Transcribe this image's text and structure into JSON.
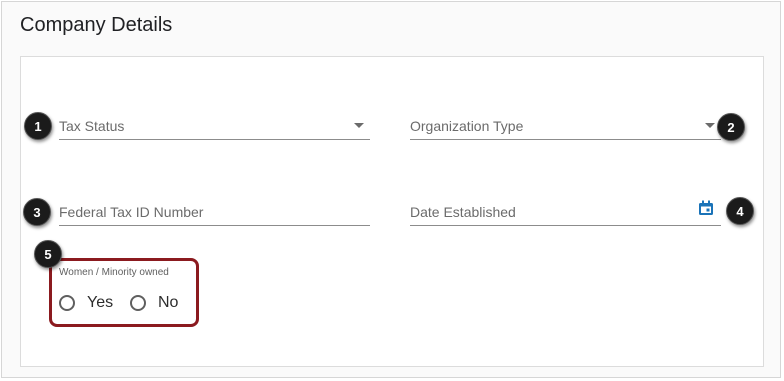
{
  "page": {
    "title": "Company Details"
  },
  "form": {
    "tax_status": {
      "label": "Tax Status"
    },
    "organization_type": {
      "label": "Organization Type"
    },
    "federal_tax_id": {
      "label": "Federal Tax ID Number"
    },
    "date_established": {
      "label": "Date Established"
    },
    "ownership": {
      "label": "Women / Minority owned",
      "options": [
        "Yes",
        "No"
      ]
    }
  },
  "callouts": [
    "1",
    "2",
    "3",
    "4",
    "5"
  ],
  "colors": {
    "highlight_border": "#8b1a1f",
    "calendar_icon": "#1a73b8",
    "callout_bg": "#1b1b1b"
  },
  "icons": {
    "dropdown": "caret-down-icon",
    "date": "calendar-icon"
  }
}
